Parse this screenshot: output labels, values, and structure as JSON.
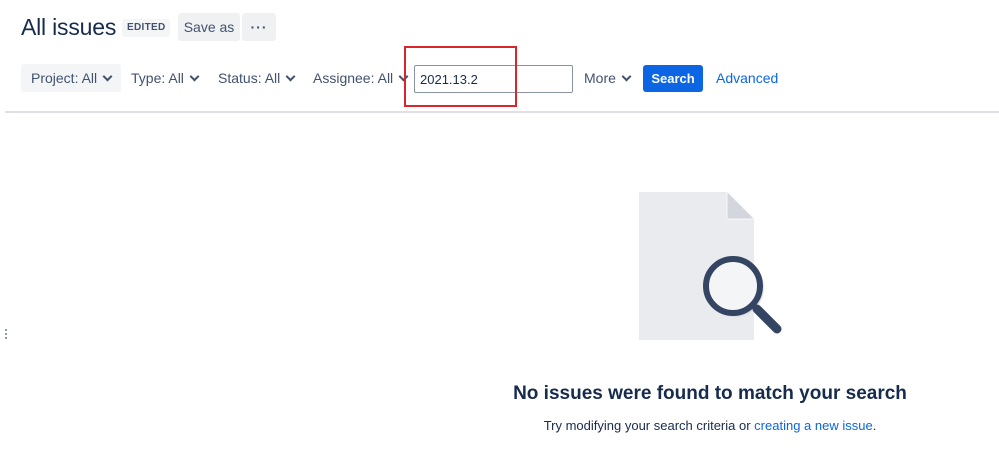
{
  "header": {
    "title": "All issues",
    "status_lozenge": "EDITED",
    "save_as_label": "Save as",
    "more_actions_label": "···"
  },
  "filters": {
    "project": "Project: All",
    "type": "Type: All",
    "status": "Status: All",
    "assignee": "Assignee: All",
    "more": "More"
  },
  "search": {
    "query": "2021.13.2",
    "button_label": "Search",
    "advanced_label": "Advanced"
  },
  "empty_state": {
    "icon": "document-search-icon",
    "title": "No issues were found to match your search",
    "description_prefix": "Try modifying your search criteria or ",
    "link_text": "creating a new issue",
    "description_suffix": "."
  },
  "colors": {
    "primary": "#0c66e4",
    "text": "#172b4d",
    "highlight": "#d8262d"
  }
}
